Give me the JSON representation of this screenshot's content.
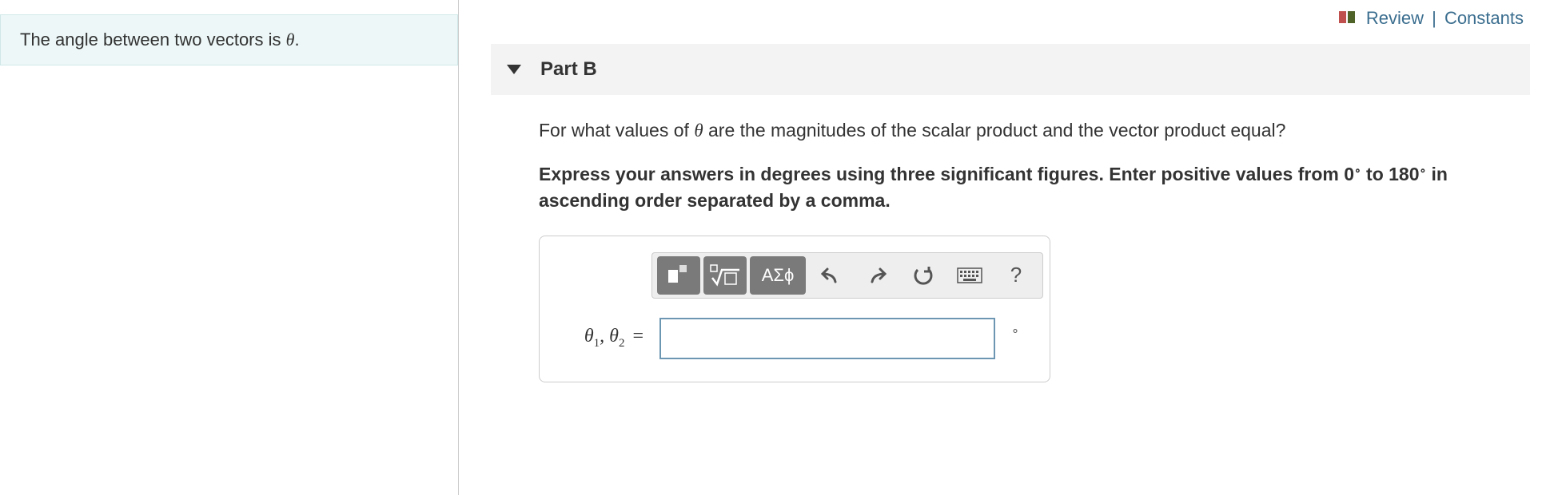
{
  "left": {
    "intro": "The angle between two vectors is θ."
  },
  "top_links": {
    "review": "Review",
    "constants": "Constants"
  },
  "part": {
    "label": "Part B"
  },
  "question": {
    "text_html": "For what values of <span class='theta'>θ</span> are the magnitudes of the scalar product and the vector product equal?",
    "instruction_html": "Express your answers in degrees using three significant figures. Enter positive values from 0<sup>∘</sup> to 180<sup>∘</sup> in ascending order separated by a comma."
  },
  "toolbar": {
    "template": "template-icon",
    "math": "math-root-icon",
    "greek": "ΑΣϕ",
    "undo": "undo-icon",
    "redo": "redo-icon",
    "reset": "reset-icon",
    "keyboard": "keyboard-icon",
    "help": "?"
  },
  "answer": {
    "label_html": "θ<span class='sub'>1</span>, θ<span class='sub'>2</span> <span class='eq'>=</span>",
    "value": "",
    "unit": "∘"
  }
}
